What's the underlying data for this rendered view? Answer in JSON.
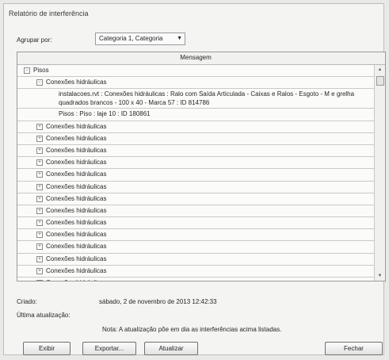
{
  "window": {
    "title": "Relatório de interferência"
  },
  "group_by": {
    "label": "Agrupar por:",
    "value": "Categoria 1, Categoria",
    "arrow": "▼"
  },
  "table": {
    "column_header": "Mensagem",
    "root": {
      "label": "Pisos",
      "toggle": "−"
    },
    "expanded_child": {
      "label": "Conexões hidráulicas",
      "toggle": "−",
      "details": [
        "instalacoes.rvt : Conexões hidráulicas : Ralo com Saída Articulada - Caixas e Ralos - Esgoto - M e grelha quadrados brancos - 100 x 40 - Marca 57 : ID 814786",
        "Pisos : Piso : laje 10 : ID 180861"
      ]
    },
    "collapsed_children": [
      "Conexões hidráulicas",
      "Conexões hidráulicas",
      "Conexões hidráulicas",
      "Conexões hidráulicas",
      "Conexões hidráulicas",
      "Conexões hidráulicas",
      "Conexões hidráulicas",
      "Conexões hidráulicas",
      "Conexões hidráulicas",
      "Conexões hidráulicas",
      "Conexões hidráulicas",
      "Conexões hidráulicas",
      "Conexões hidráulicas",
      "Conexões hidráulicas",
      "Conexões hidráulicas",
      "Conexões hidráulicas",
      "Conexões hidráulicas"
    ],
    "collapsed_toggle": "+"
  },
  "meta": {
    "created_label": "Criado:",
    "created_value": "sábado, 2 de novembro de 2013 12:42:33",
    "updated_label": "Última atualização:",
    "note": "Nota: A atualização põe em dia as interferências acima listadas."
  },
  "buttons": {
    "exibir": "Exibir",
    "exportar": "Exportar...",
    "atualizar": "Atualizar",
    "fechar": "Fechar"
  }
}
